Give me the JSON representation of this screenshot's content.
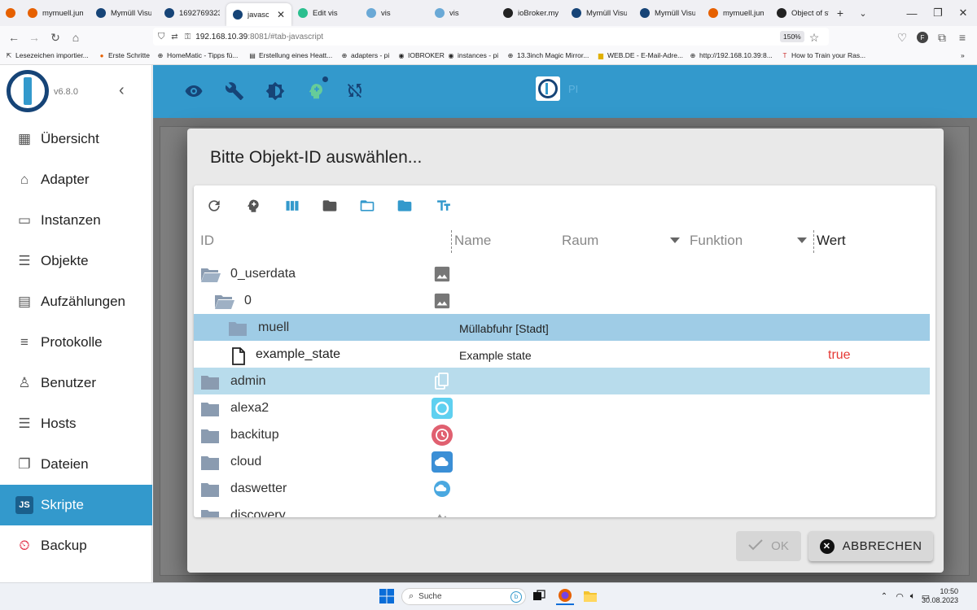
{
  "browser": {
    "tabs": [
      {
        "label": "mymuell.jumomin",
        "color": "#e66000"
      },
      {
        "label": "Mymüll Visual",
        "color": "#164477"
      },
      {
        "label": "16927693237",
        "color": "#164477"
      },
      {
        "label": "javascript",
        "color": "#164477",
        "active": true
      },
      {
        "label": "Edit vis",
        "color": "#2bbf8f"
      },
      {
        "label": "vis",
        "color": "#6aa9d6"
      },
      {
        "label": "vis",
        "color": "#6aa9d6"
      },
      {
        "label": "ioBroker.mym",
        "color": "#222222"
      },
      {
        "label": "Mymüll Visual",
        "color": "#164477"
      },
      {
        "label": "Mymüll Visual",
        "color": "#164477"
      },
      {
        "label": "mymuell.jumomin",
        "color": "#e66000"
      },
      {
        "label": "Object of stat",
        "color": "#222222"
      }
    ],
    "url_host": "192.168.10.39",
    "url_rest": ":8081/#tab-javascript",
    "zoom": "150%",
    "bookmarks": [
      "Lesezeichen importier...",
      "Erste Schritte",
      "HomeMatic - Tipps fü...",
      "Erstellung eines Heatt...",
      "adapters - pi",
      "IOBROKER",
      "instances - pi",
      "13.3inch Magic Mirror...",
      "WEB.DE - E-Mail-Adre...",
      "http://192.168.10.39:8...",
      "How to Train your Ras..."
    ]
  },
  "app": {
    "version": "v6.8.0",
    "menu": [
      {
        "label": "Übersicht",
        "icon": "grid-icon"
      },
      {
        "label": "Adapter",
        "icon": "store-icon"
      },
      {
        "label": "Instanzen",
        "icon": "instances-icon"
      },
      {
        "label": "Objekte",
        "icon": "list-icon"
      },
      {
        "label": "Aufzählungen",
        "icon": "enum-icon"
      },
      {
        "label": "Protokolle",
        "icon": "log-icon"
      },
      {
        "label": "Benutzer",
        "icon": "user-icon"
      },
      {
        "label": "Hosts",
        "icon": "hosts-icon"
      },
      {
        "label": "Dateien",
        "icon": "files-icon"
      },
      {
        "label": "Skripte",
        "icon": "js-icon",
        "active": true
      },
      {
        "label": "Backup",
        "icon": "backup-icon"
      }
    ],
    "topbar_host": "PI",
    "accent": "#3399cc",
    "brand_dark": "#164477"
  },
  "dialog": {
    "title": "Bitte Objekt-ID auswählen...",
    "columns": {
      "id": "ID",
      "name": "Name",
      "room": "Raum",
      "function": "Funktion",
      "value": "Wert"
    },
    "rows": [
      {
        "id": "0_userdata",
        "name": "",
        "value": ""
      },
      {
        "id": "0",
        "name": "",
        "value": ""
      },
      {
        "id": "muell",
        "name": "Müllabfuhr [Stadt]",
        "value": ""
      },
      {
        "id": "example_state",
        "name": "Example state",
        "value": "true"
      },
      {
        "id": "admin",
        "name": "",
        "value": ""
      },
      {
        "id": "alexa2",
        "name": "",
        "value": ""
      },
      {
        "id": "backitup",
        "name": "",
        "value": ""
      },
      {
        "id": "cloud",
        "name": "",
        "value": ""
      },
      {
        "id": "daswetter",
        "name": "",
        "value": ""
      },
      {
        "id": "discovery",
        "name": "",
        "value": ""
      }
    ],
    "ok_label": "OK",
    "cancel_label": "ABBRECHEN"
  },
  "taskbar": {
    "search_placeholder": "Suche",
    "time": "10:50",
    "date": "30.08.2023"
  }
}
